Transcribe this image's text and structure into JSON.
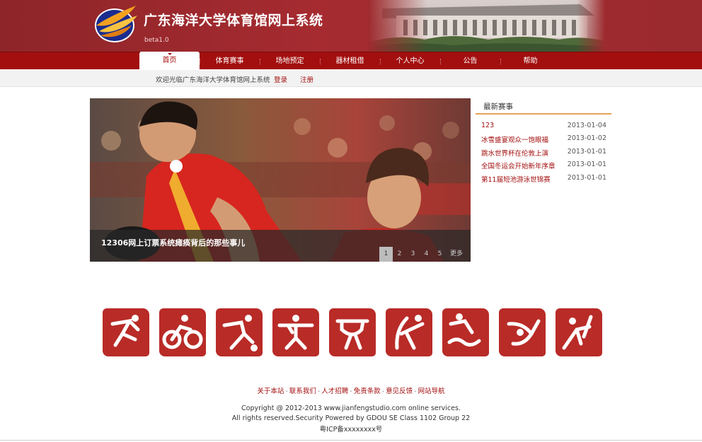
{
  "header": {
    "title": "广东海洋大学体育馆网上系统",
    "version": "beta1.0"
  },
  "nav": {
    "items": [
      {
        "label": "首页",
        "active": true
      },
      {
        "label": "体育赛事"
      },
      {
        "label": "场地预定"
      },
      {
        "label": "器材租借"
      },
      {
        "label": "个人中心"
      },
      {
        "label": "公告"
      },
      {
        "label": "帮助"
      }
    ]
  },
  "subbar": {
    "welcome": "欢迎光临广东海洋大学体育馆网上系统",
    "login": "登录",
    "register": "注册"
  },
  "slider": {
    "caption": "12306网上订票系统瘫痪背后的那些事儿",
    "pages": [
      "1",
      "2",
      "3",
      "4",
      "5"
    ],
    "active_page": "1",
    "more": "更多"
  },
  "events": {
    "title": "最新赛事",
    "items": [
      {
        "name": "123",
        "date": "2013-01-04"
      },
      {
        "name": "冰雪盛宴观众一饱眼福",
        "date": "2013-01-02"
      },
      {
        "name": "跳水世界杯在伦敦上演",
        "date": "2013-01-01"
      },
      {
        "name": "全国冬运会开始新年序章",
        "date": "2013-01-01"
      },
      {
        "name": "第11届短池游泳世锦赛",
        "date": "2013-01-01"
      }
    ]
  },
  "seals": {
    "color": "#b92b27",
    "icons": [
      "running-icon",
      "cycling-icon",
      "football-icon",
      "weightlifting-icon",
      "gymnastics-icon",
      "archery-icon",
      "swimming-icon",
      "diving-icon",
      "fencing-icon"
    ]
  },
  "footer": {
    "links": [
      "关于本站",
      "联系我们",
      "人才招聘",
      "免责条款",
      "意见反馈",
      "网站导航"
    ],
    "separator": "-",
    "copyright_line1": "Copyright @ 2012-2013 www.jianfengstudio.com online services.",
    "copyright_line2": "All rights reserved.Security Powered by GDOU SE Class 1102 Group 22",
    "icp": "粤ICP备xxxxxxxx号"
  },
  "colors": {
    "brand": "#a30f0f",
    "header_bg": "#9b2a2e",
    "accent_orange": "#e6a35a"
  }
}
